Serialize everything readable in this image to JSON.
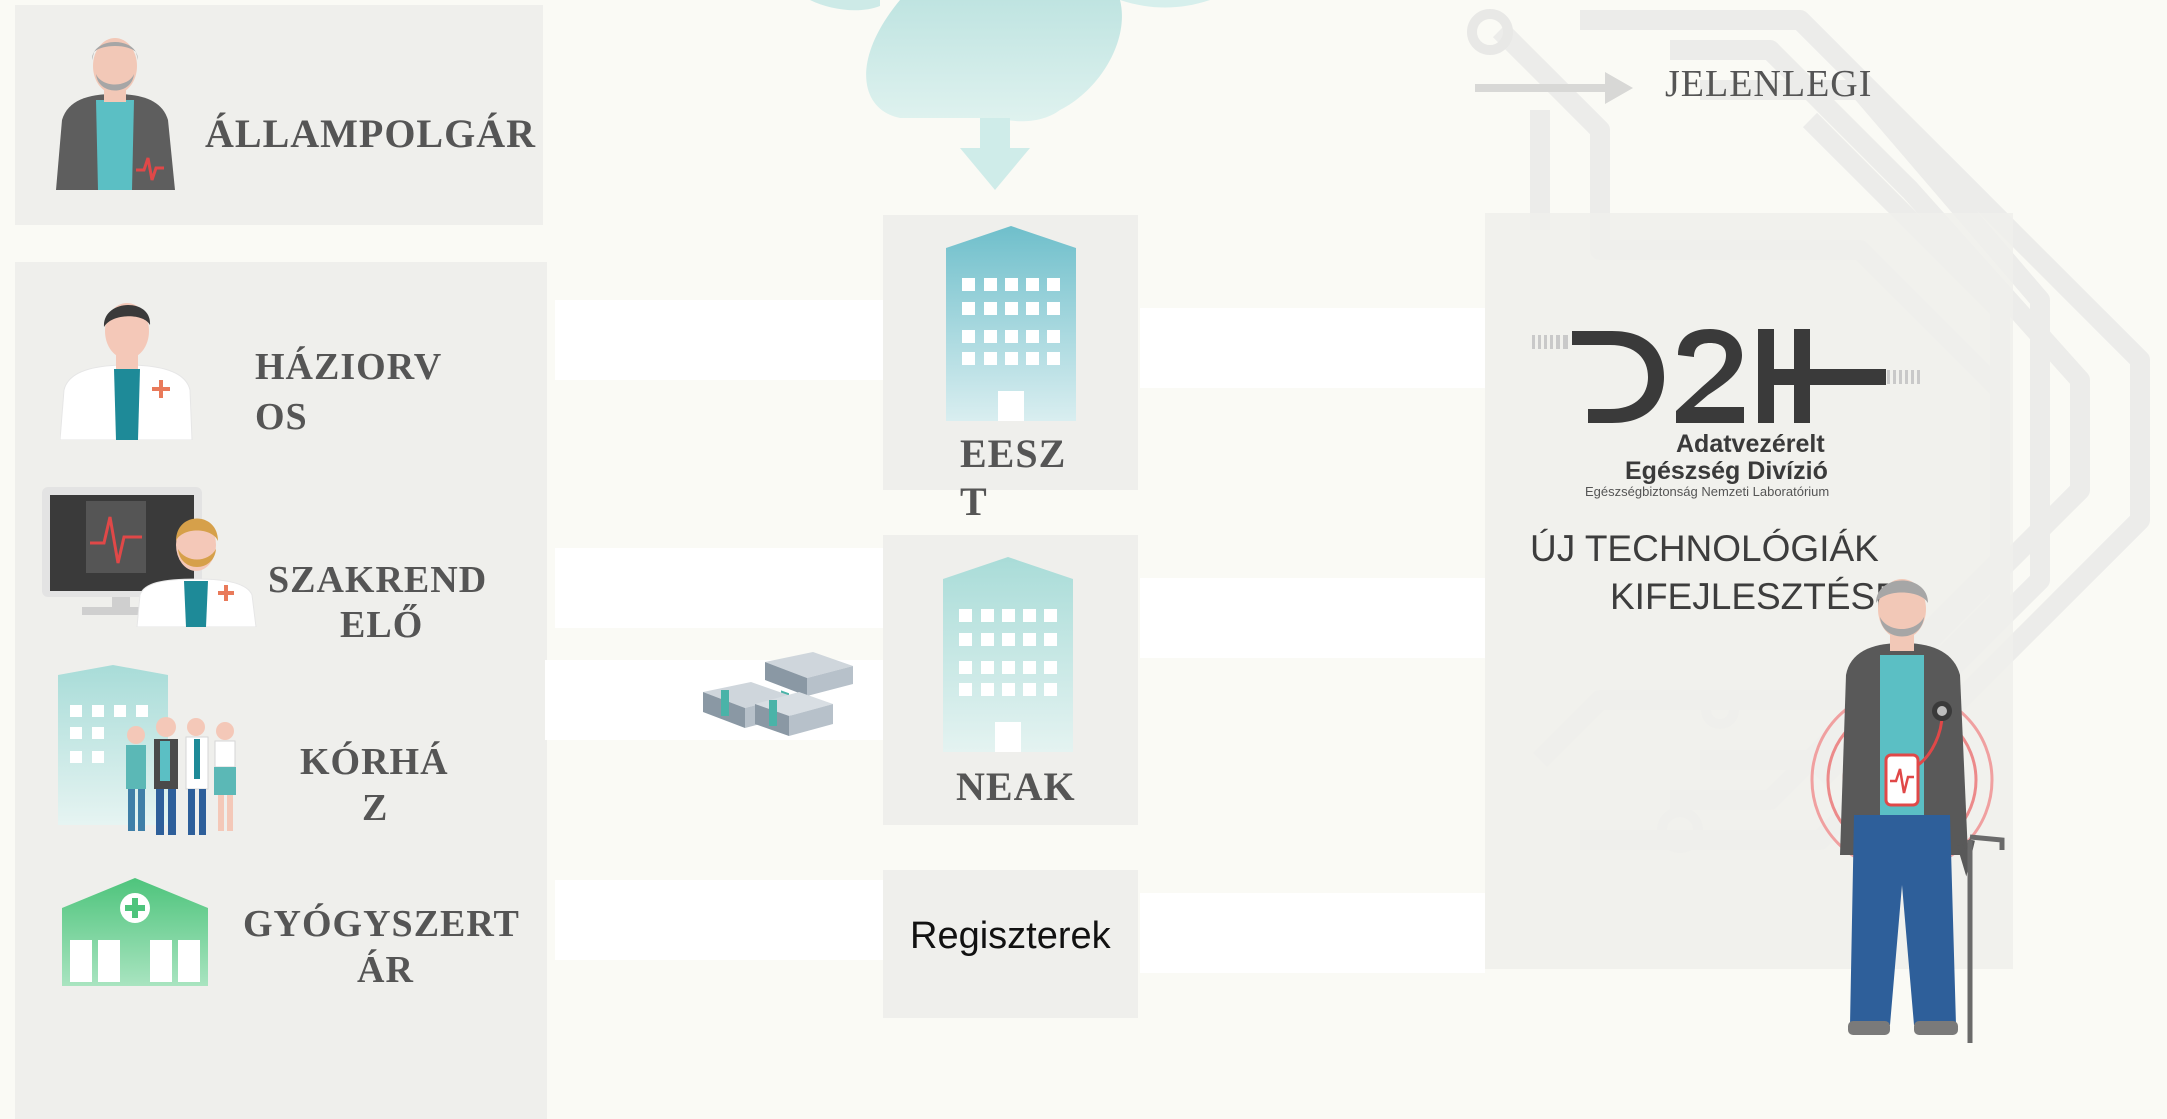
{
  "actors": {
    "citizen": "ÁLLAMPOLGÁR",
    "gp_line1": "HÁZIORV",
    "gp_line2": "OS",
    "specialist_line1": "SZAKREND",
    "specialist_line2": "ELŐ",
    "hospital_line1": "KÓRHÁ",
    "hospital_line2": "Z",
    "pharmacy_line1": "GYÓGYSZERT",
    "pharmacy_line2": "ÁR"
  },
  "center": {
    "eeszt_line1": "EESZ",
    "eeszt_line2": "T",
    "neak": "NEAK",
    "registers": "Regiszterek"
  },
  "right": {
    "current_label": "JELENLEGI",
    "logo_line1": "Adatvezérelt",
    "logo_line2": "Egészség Divízió",
    "logo_line3": "Egészségbiztonság Nemzeti Laboratórium",
    "new_tech_line1": "ÚJ TECHNOLÓGIÁK",
    "new_tech_line2": "KIFEJLESZTÉSE"
  },
  "icons": {
    "citizen": "citizen-avatar-icon",
    "gp": "doctor-icon",
    "specialist": "monitor-doctor-icon",
    "hospital": "hospital-people-icon",
    "pharmacy": "pharmacy-icon",
    "cloud": "cloud-icon",
    "building": "building-icon",
    "money": "money-stack-icon",
    "arrow": "arrow-right-icon",
    "logo": "d2h-logo",
    "elder": "elderly-man-monitor-icon"
  },
  "colors": {
    "accent_teal": "#7cc6cf",
    "label_grey": "#555555",
    "panel_grey": "#efefec",
    "pharmacy_green": "#5fcf8a",
    "alert_red": "#e04848"
  }
}
